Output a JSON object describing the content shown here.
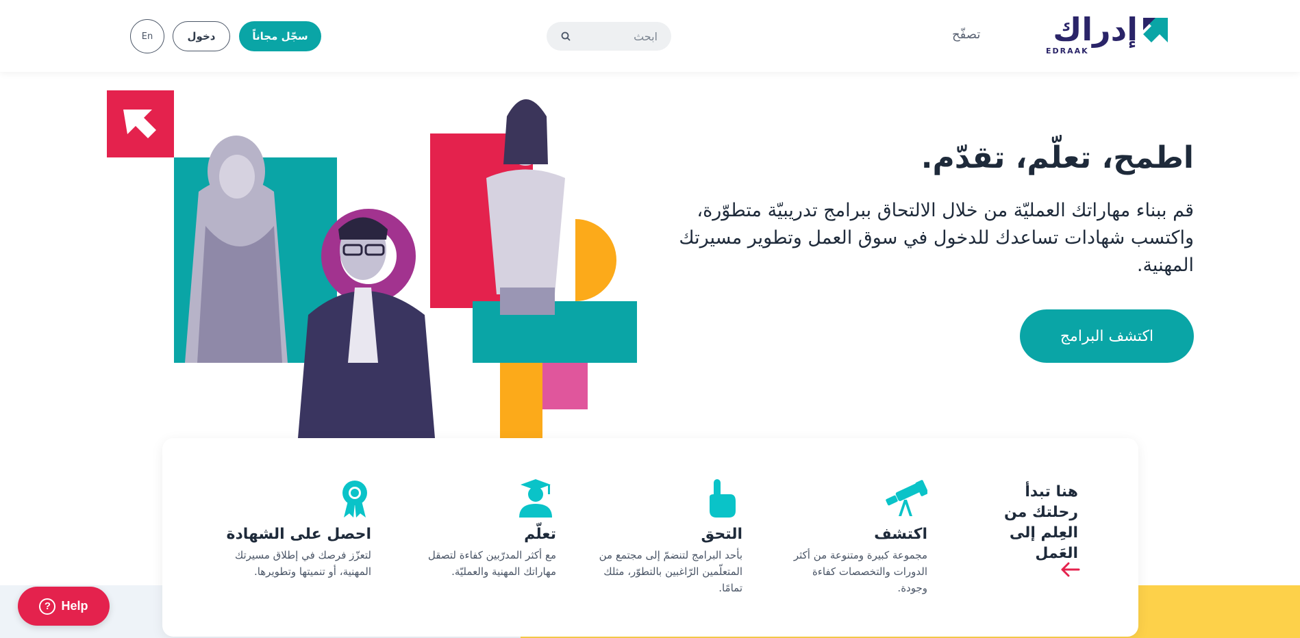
{
  "header": {
    "logo_text": "إدراك",
    "logo_sub": "EDRAAK",
    "browse_label": "تصفّح",
    "search_placeholder": "ابحث",
    "signup_label": "سجّل مجاناً",
    "login_label": "دخول",
    "lang_label": "En"
  },
  "hero": {
    "title": "اطمح، تعلّم، تقدّم.",
    "description": "قم ببناء مهاراتك العمليّة من خلال الالتحاق ببرامج تدريبيّة متطوّرة، واكتسب شهادات تساعدك للدخول في سوق العمل وتطوير مسيرتك المهنية.",
    "cta_label": "اكتشف البرامج"
  },
  "journey": {
    "title": "هنا تبدأ رحلتك من العِلم إلى العَمل",
    "steps": [
      {
        "icon": "telescope-icon",
        "title": "اكتشف",
        "text": "مجموعة كبيرة ومتنوعة من أكثر الدورات والتخصصات كفاءة وجودة."
      },
      {
        "icon": "pointing-hand-icon",
        "title": "التحق",
        "text": "بأحد البرامج لتنضمّ إلى مجتمع من المتعلّمين الرّاغبين بالتطوّر، مثلك تمامًا."
      },
      {
        "icon": "graduate-icon",
        "title": "تعلّم",
        "text": "مع أكثر المدرّبين كفاءة لتصقل مهاراتك المهنية والعمليّة."
      },
      {
        "icon": "award-ribbon-icon",
        "title": "احصل على الشهادة",
        "text": "لتعزّز فرصك في إطلاق مسيرتك المهنية، أو تنميتها وتطويرها."
      }
    ]
  },
  "help": {
    "label": "Help"
  },
  "colors": {
    "teal": "#0aa5a6",
    "navy": "#2a2468",
    "red": "#e4224d",
    "purple": "#a2338f",
    "orange": "#fcaa1a",
    "pink": "#e0569c",
    "yellow": "#fdd14a",
    "text": "#1e2a3a"
  }
}
